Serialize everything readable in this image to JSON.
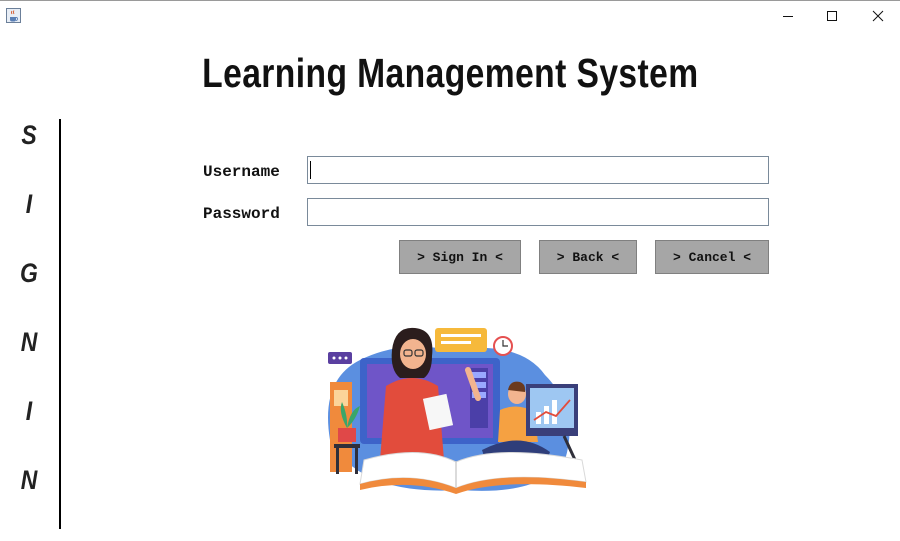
{
  "window": {
    "app_icon": "java-cup-icon",
    "controls": [
      "minimize-icon",
      "maximize-icon",
      "close-icon"
    ]
  },
  "title": "Learning Management System",
  "side_letters": [
    "S",
    "I",
    "G",
    "N",
    "I",
    "N"
  ],
  "form": {
    "username_label": "Username",
    "password_label": "Password",
    "username_value": "",
    "password_value": ""
  },
  "buttons": {
    "sign_in": "> Sign In <",
    "back": "> Back <",
    "cancel": "> Cancel <"
  },
  "illustration": "teacher-and-student-online-learning-illustration",
  "colors": {
    "button_bg": "#a6a6a6",
    "field_border": "#7a8a9a",
    "divider": "#000000"
  }
}
